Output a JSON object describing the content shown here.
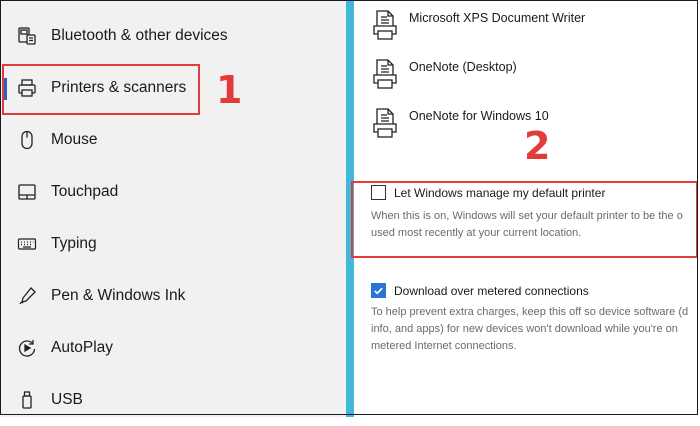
{
  "sidebar": {
    "items": [
      {
        "label": "Bluetooth & other devices",
        "icon": "bluetooth-devices-icon"
      },
      {
        "label": "Printers & scanners",
        "icon": "printer-icon"
      },
      {
        "label": "Mouse",
        "icon": "mouse-icon"
      },
      {
        "label": "Touchpad",
        "icon": "touchpad-icon"
      },
      {
        "label": "Typing",
        "icon": "keyboard-icon"
      },
      {
        "label": "Pen & Windows Ink",
        "icon": "pen-icon"
      },
      {
        "label": "AutoPlay",
        "icon": "autoplay-icon"
      },
      {
        "label": "USB",
        "icon": "usb-icon"
      }
    ],
    "active_item": "Printers & scanners"
  },
  "annotations": {
    "step1": "1",
    "step2": "2",
    "color": "#e23b3b"
  },
  "printers": [
    {
      "name": "Microsoft XPS Document Writer"
    },
    {
      "name": "OneNote (Desktop)"
    },
    {
      "name": "OneNote for Windows 10"
    }
  ],
  "settings": {
    "manage_default": {
      "label": "Let Windows manage my default printer",
      "checked": false,
      "description_line1": "When this is on, Windows will set your default printer to be the o",
      "description_line2": "used most recently at your current location."
    },
    "metered": {
      "label": "Download over metered connections",
      "checked": true,
      "description_line1": "To help prevent extra charges, keep this off so device software (d",
      "description_line2": "info, and apps) for new devices won't download while you're on",
      "description_line3": "metered Internet connections."
    }
  },
  "colors": {
    "accent": "#2b74d5",
    "divider": "#42b8d9",
    "sidebar_bg": "#f1f1f1"
  }
}
